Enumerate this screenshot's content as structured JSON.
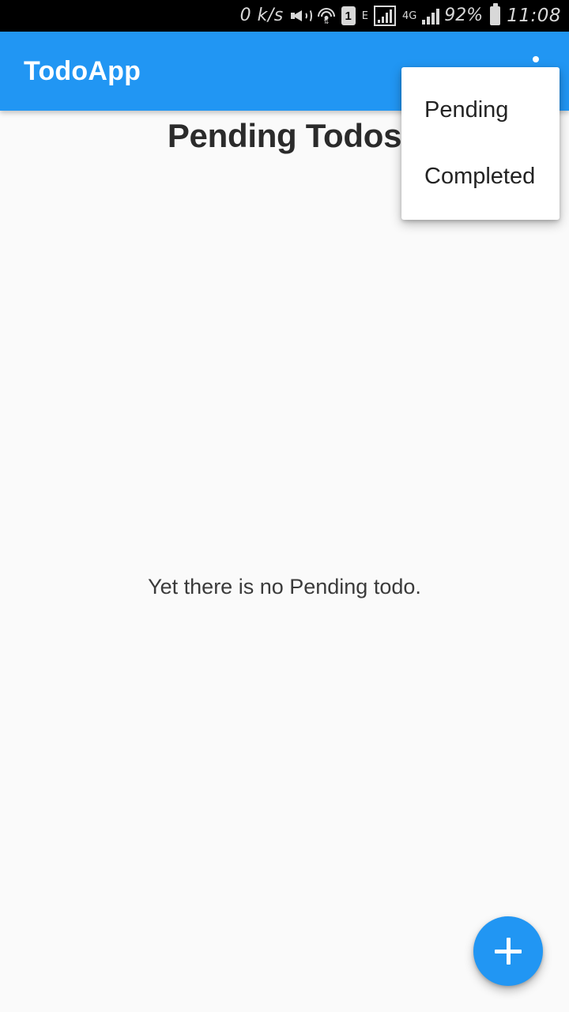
{
  "status_bar": {
    "network_speed": "0 k/s",
    "mute_icon": "mute-icon",
    "wifi_icon": "wifi-icon",
    "sim_label": "1",
    "network_type_1": "E",
    "signal_icon_1": "signal-bars-icon",
    "network_type_2": "4G",
    "signal_icon_2": "signal-bars-icon",
    "battery_percent": "92%",
    "battery_icon": "battery-icon",
    "clock": "11:08"
  },
  "app_bar": {
    "title": "TodoApp",
    "overflow_icon": "overflow-menu-icon",
    "background_color": "#2196f3",
    "title_color": "#ffffff"
  },
  "overflow_menu": {
    "visible": true,
    "items": [
      {
        "label": "Pending"
      },
      {
        "label": "Completed"
      }
    ]
  },
  "main": {
    "page_title": "Pending Todos",
    "empty_state": "Yet there is no Pending todo.",
    "background_color": "#fafafa"
  },
  "fab": {
    "icon": "plus-icon",
    "label": "+",
    "color": "#2196f3"
  }
}
